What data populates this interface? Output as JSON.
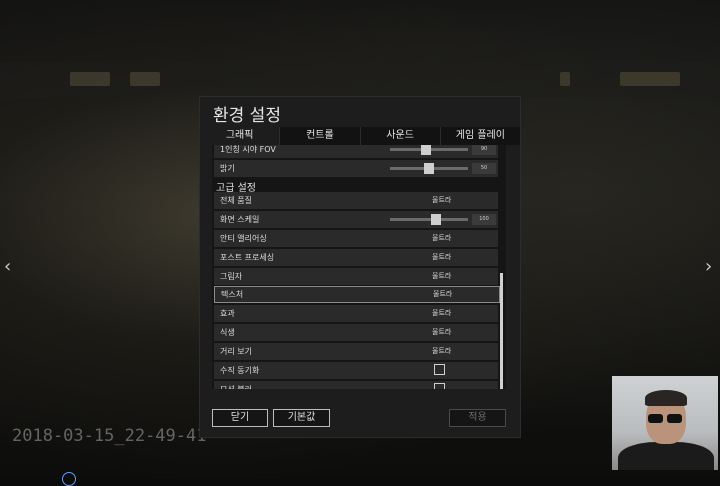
{
  "dialog": {
    "title": "환경 설정",
    "tabs": [
      {
        "label": "그래픽",
        "active": true
      },
      {
        "label": "컨트롤",
        "active": false
      },
      {
        "label": "사운드",
        "active": false
      },
      {
        "label": "게임 플레이",
        "active": false
      }
    ]
  },
  "settings": {
    "top_rows": [
      {
        "label": "1인칭 시야 FOV",
        "value": "90",
        "slider_fraction": 0.45
      },
      {
        "label": "밝기",
        "value": "50",
        "slider_fraction": 0.5
      }
    ],
    "section_title": "고급 설정",
    "overall_quality": {
      "label": "전체 품질",
      "value": "울트라"
    },
    "render_scale": {
      "label": "화면 스케일",
      "value": "100",
      "slider_fraction": 0.6
    },
    "quality_rows": [
      {
        "label": "안티 앨리어싱",
        "value": "울트라"
      },
      {
        "label": "포스트 프로세싱",
        "value": "울트라"
      },
      {
        "label": "그림자",
        "value": "울트라"
      },
      {
        "label": "텍스처",
        "value": "울트라"
      },
      {
        "label": "효과",
        "value": "울트라"
      },
      {
        "label": "식생",
        "value": "울트라"
      },
      {
        "label": "거리 보기",
        "value": "울트라"
      }
    ],
    "toggle_rows": [
      {
        "label": "수직 동기화",
        "checked": false
      },
      {
        "label": "모션 블러",
        "checked": false
      }
    ]
  },
  "buttons": {
    "close": "닫기",
    "default": "기본값",
    "apply": "적용"
  },
  "overlay": {
    "timestamp": "2018-03-15_22-49-41"
  },
  "icons": [
    "chevron-left-icon",
    "chevron-right-icon"
  ]
}
